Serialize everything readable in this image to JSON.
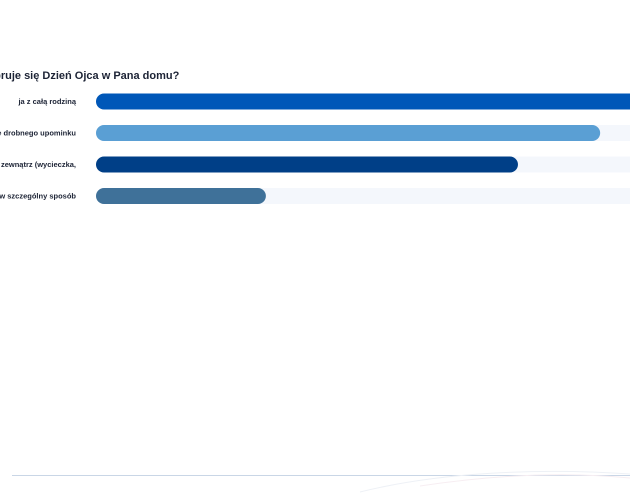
{
  "chart_data": {
    "type": "bar",
    "orientation": "horizontal",
    "title": "ebruje się Dzień Ojca w Pana domu?",
    "categories": [
      "ja z całą rodziną",
      "ie drobnego upominku",
      "na zewnątrz (wycieczka,",
      "w szczególny sposób"
    ],
    "values": [
      100,
      92,
      77,
      31
    ],
    "xlim": [
      0,
      100
    ],
    "colors": [
      "#0057b8",
      "#5a9fd4",
      "#003f87",
      "#3f7199"
    ],
    "track_color": "#f4f7fc",
    "grid": false,
    "legend": "none"
  }
}
